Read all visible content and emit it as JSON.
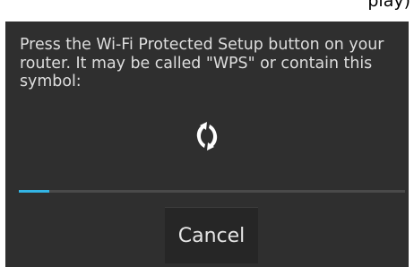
{
  "header_partial_text": "play)",
  "dialog": {
    "message": "Press the Wi-Fi Protected Setup button on your router. It may be called \"WPS\" or contain this symbol:",
    "icon": "wps-icon",
    "progress_fraction": 0.08,
    "cancel_label": "Cancel"
  },
  "colors": {
    "dialog_background": "#2f2f2f",
    "progress_accent": "#33b5e5",
    "progress_track": "#4a4a4a",
    "text": "#dddddd"
  }
}
